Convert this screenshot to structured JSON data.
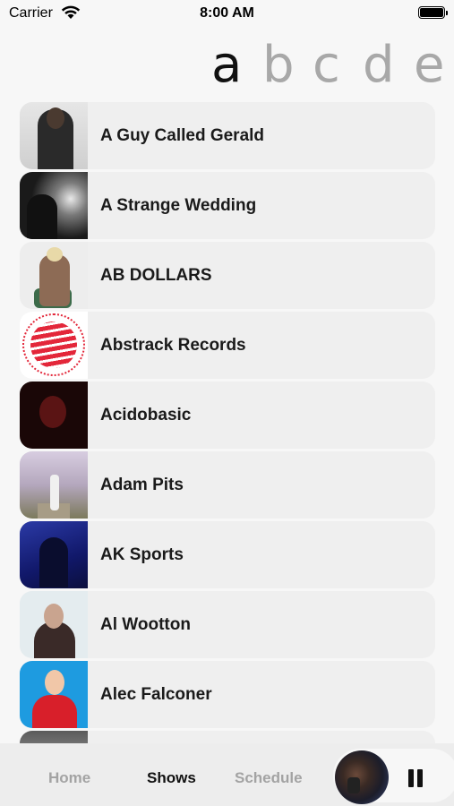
{
  "status_bar": {
    "carrier": "Carrier",
    "time": "8:00 AM",
    "icons": [
      "wifi-icon",
      "battery-icon"
    ]
  },
  "letter_selector": {
    "letters": [
      "a",
      "b",
      "c",
      "d",
      "e"
    ],
    "selected": "a"
  },
  "artists": [
    {
      "name": "A Guy Called Gerald"
    },
    {
      "name": "A Strange Wedding"
    },
    {
      "name": "AB DOLLARS"
    },
    {
      "name": "Abstrack Records"
    },
    {
      "name": "Acidobasic"
    },
    {
      "name": "Adam Pits"
    },
    {
      "name": "AK Sports"
    },
    {
      "name": "Al Wootton"
    },
    {
      "name": "Alec Falconer"
    }
  ],
  "tabs": {
    "home": "Home",
    "shows": "Shows",
    "schedule": "Schedule",
    "active": "Shows"
  },
  "player": {
    "state": "playing",
    "control_icon": "pause-icon"
  },
  "colors": {
    "background": "#f7f7f7",
    "row_background": "#efefef",
    "active_text": "#111111",
    "inactive_text": "#a3a3a3"
  }
}
